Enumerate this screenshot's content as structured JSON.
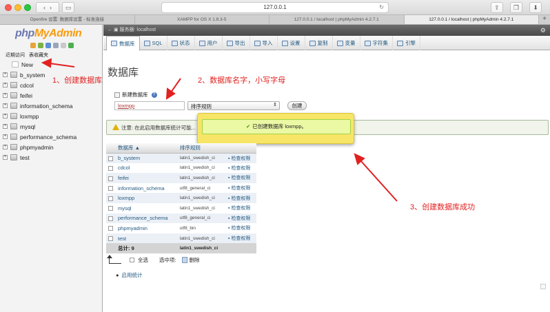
{
  "browser": {
    "address": "127.0.0.1",
    "tabs": [
      {
        "label": "Openfire 设置: 数据库设置 - 标准连接",
        "active": false
      },
      {
        "label": "XAMPP for OS X 1.8.3-5",
        "active": false
      },
      {
        "label": "127.0.0.1 / localhost | phpMyAdmin 4.2.7.1",
        "active": false
      },
      {
        "label": "127.0.0.1 / localhost | phpMyAdmin 4.2.7.1",
        "active": true
      }
    ]
  },
  "sidebar": {
    "logo_php": "php",
    "logo_myadmin": "MyAdmin",
    "nav_recent": "近期访问",
    "nav_favorites": "表收藏夹",
    "databases": [
      "New",
      "b_system",
      "cdcol",
      "feifei",
      "information_schema",
      "loxmpp",
      "mysql",
      "performance_schema",
      "phpmyadmin",
      "test"
    ]
  },
  "main": {
    "server_breadcrumb": "服务器: localhost",
    "tabs": [
      "数据库",
      "SQL",
      "状态",
      "用户",
      "导出",
      "导入",
      "设置",
      "复制",
      "变量",
      "字符集",
      "引擎"
    ],
    "heading": "数据库",
    "create_label": "新建数据库",
    "db_name_value": "loxmpp",
    "collation_placeholder": "排序规则",
    "create_button": "创建",
    "notice": "注意: 在此启用数据库统计可能...",
    "success_message": "已创建数据库 loxmpp。",
    "table": {
      "col_database": "数据库",
      "col_collation": "排序规则",
      "rows": [
        {
          "name": "b_system",
          "collation": "latin1_swedish_ci",
          "action": "检查权限"
        },
        {
          "name": "cdcol",
          "collation": "latin1_swedish_ci",
          "action": "检查权限"
        },
        {
          "name": "feifei",
          "collation": "latin1_swedish_ci",
          "action": "检查权限"
        },
        {
          "name": "information_schema",
          "collation": "utf8_general_ci",
          "action": "检查权限"
        },
        {
          "name": "loxmpp",
          "collation": "latin1_swedish_ci",
          "action": "检查权限"
        },
        {
          "name": "mysql",
          "collation": "latin1_swedish_ci",
          "action": "检查权限"
        },
        {
          "name": "performance_schema",
          "collation": "utf8_general_ci",
          "action": "检查权限"
        },
        {
          "name": "phpmyadmin",
          "collation": "utf8_bin",
          "action": "检查权限"
        },
        {
          "name": "test",
          "collation": "latin1_swedish_ci",
          "action": "检查权限"
        }
      ],
      "total_label": "总计: 9",
      "total_collation": "latin1_swedish_ci"
    },
    "select_all": "全选",
    "with_selected": "选中项:",
    "delete": "删除",
    "enable_stats": "启用统计"
  },
  "annotations": {
    "step1": "1、创建数据库",
    "step2": "2、数据库名字，小写字母",
    "step3": "3、创建数据库成功"
  },
  "colors": {
    "annotation": "#e22020",
    "link": "#235a81",
    "popup": "#f7e567"
  }
}
